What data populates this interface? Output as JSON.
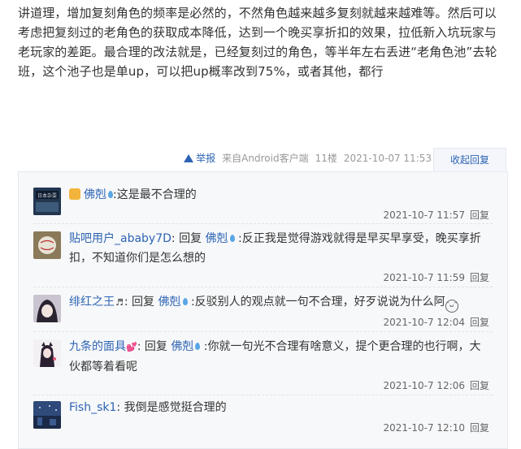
{
  "post": {
    "body": "讲道理，增加复刻角色的频率是必然的，不然角色越来越多复刻就越来越难等。然后可以考虑把复刻过的老角色的获取成本降低，达到一个晚买享折扣的效果，拉低新入坑玩家与老玩家的差距。最合理的改法就是，已经复刻过的角色，等半年左右丢进“老角色池”去轮班，这个池子也是单up，可以把up概率改到75%，或者其他，都行",
    "report_label": "举报",
    "source": "来自Android客户端",
    "floor": "11楼",
    "datetime": "2021-10-07 11:53",
    "collapse_label": "收起回复"
  },
  "replies": [
    {
      "user": "佛剋",
      "reply_word": "",
      "target": "",
      "text": ":这是最不合理的",
      "time": "2021-10-7 11:57",
      "reply_label": "回复"
    },
    {
      "user": "贴吧用户_ababy7D",
      "reply_word": "回复",
      "target": "佛剋",
      "text": ":反正我是觉得游戏就得是早买早享受，晚买享折扣，不知道你们是怎么想的",
      "time": "2021-10-7 11:59",
      "reply_label": "回复"
    },
    {
      "user": "绯红之王",
      "reply_word": "回复",
      "target": "佛剋",
      "text": ":反驳别人的观点就一句不合理，好歹说说为什么阿",
      "time": "2021-10-7 12:04",
      "reply_label": "回复"
    },
    {
      "user": "九条的面具",
      "reply_word": "回复",
      "target": "佛剋",
      "text": ":你就一句光不合理有啥意义，提个更合理的也行啊，大伙都等着看呢",
      "time": "2021-10-7 12:06",
      "reply_label": "回复"
    },
    {
      "user": "Fish_sk1",
      "reply_word": "",
      "target": "",
      "text": ": 我倒是感觉挺合理的",
      "time": "2021-10-7 12:10",
      "reply_label": "回复"
    }
  ],
  "avatar_texts": {
    "a1": "日本杂耍"
  },
  "icons": {
    "report": "warning-triangle-icon",
    "level": "fan-badge-icon",
    "water": "water-drop-icon",
    "note": "music-note-icon",
    "heart": "heart-icon",
    "smile": "smile-emoji-icon"
  },
  "colors": {
    "link": "#2d64b3",
    "panel": "#f7f8fa",
    "border": "#e5e9ef"
  }
}
